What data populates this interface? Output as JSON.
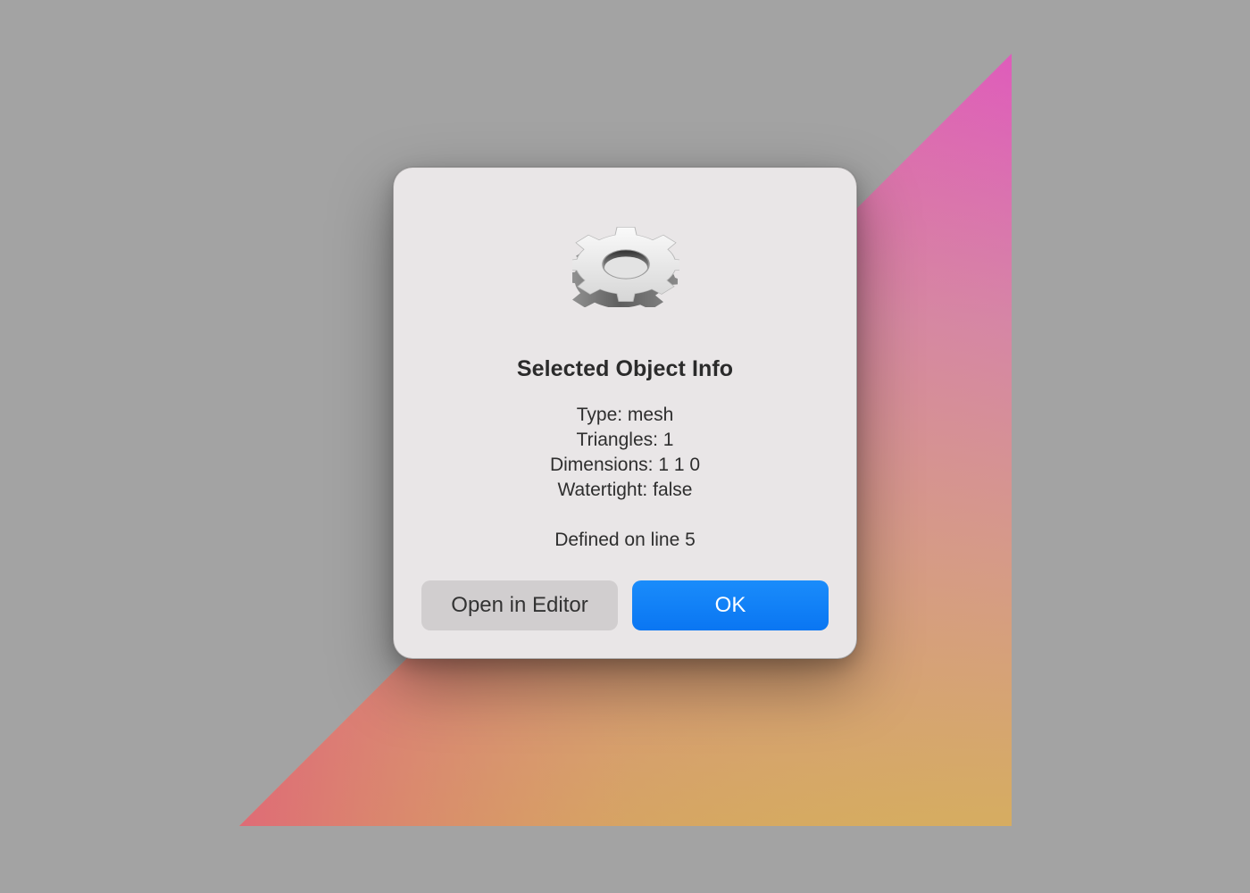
{
  "background": {
    "color": "#a3a3a3",
    "gradient_colors": [
      "#de5fb8",
      "#d4949b",
      "#d8b05c",
      "#e06a78"
    ]
  },
  "dialog": {
    "icon": "gear-icon",
    "title": "Selected Object Info",
    "info_lines": [
      "Type: mesh",
      "Triangles: 1",
      "Dimensions: 1 1 0",
      "Watertight: false"
    ],
    "defined_line": "Defined on line 5",
    "buttons": {
      "secondary_label": "Open in Editor",
      "primary_label": "OK",
      "primary_color": "#0a7cf6"
    }
  }
}
